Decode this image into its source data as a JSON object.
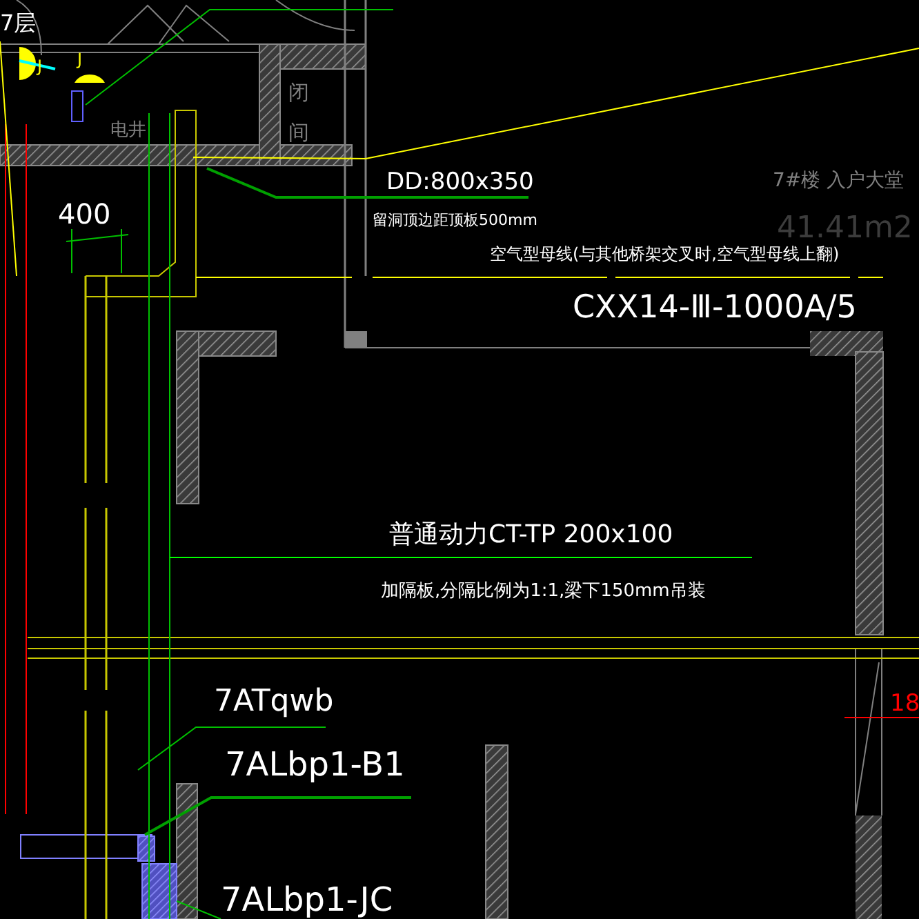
{
  "labels": [
    {
      "text": "7层",
      "color": "#ffffff"
    },
    {
      "text": "J",
      "color": "#ffff00"
    },
    {
      "text": "J",
      "color": "#ffff00"
    },
    {
      "text": "电井",
      "color": "#808080"
    },
    {
      "text": "闭",
      "color": "#808080"
    },
    {
      "text": "间",
      "color": "#808080"
    },
    {
      "text": "400",
      "color": "#ffffff"
    },
    {
      "text": "DD:800x350",
      "color": "#ffffff"
    },
    {
      "text": "7#楼 入户大堂",
      "color": "#808080"
    },
    {
      "text": "留洞顶边距顶板500mm",
      "color": "#ffffff"
    },
    {
      "text": "41.41m2",
      "color": "#3c3c3c"
    },
    {
      "text": "空气型母线(与其他桥架交叉时,空气型母线上翻)",
      "color": "#ffffff"
    },
    {
      "text": "CXX14-Ⅲ-1000A/5",
      "color": "#ffffff"
    },
    {
      "text": "普通动力CT-TP 200x100",
      "color": "#ffffff"
    },
    {
      "text": "加隔板,分隔比例为1:1,梁下150mm吊装",
      "color": "#ffffff"
    },
    {
      "text": "7ATqwb",
      "color": "#ffffff"
    },
    {
      "text": "7ALbp1-B1",
      "color": "#ffffff"
    },
    {
      "text": "7ALbp1-JC",
      "color": "#ffffff"
    },
    {
      "text": "18",
      "color": "#ff0000"
    }
  ]
}
